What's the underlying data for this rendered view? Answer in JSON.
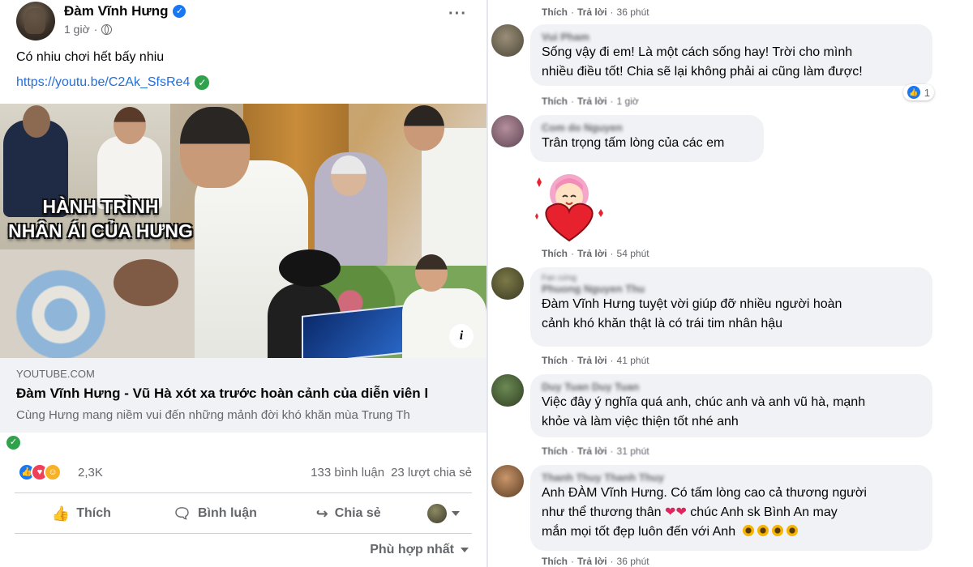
{
  "post": {
    "author": "Đàm Vĩnh Hưng",
    "time": "1 giờ",
    "text": "Có nhiu chơi hết bấy nhiu",
    "link": "https://youtu.be/C2Ak_SfsRe4",
    "thumbnail_title_line1": "HÀNH TRÌNH",
    "thumbnail_title_line2": "NHÂN ÁI CỦA HƯNG",
    "info_symbol": "i",
    "link_domain": "YOUTUBE.COM",
    "link_title": "Đàm Vĩnh Hưng - Vũ Hà xót xa trước hoàn cảnh của diễn viên l",
    "link_description": "Cùng Hưng mang niềm vui đến những mảnh đời khó khăn mùa Trung Th",
    "reaction_count": "2,3K",
    "comments_count": "133 bình luận",
    "shares_count": "23 lượt chia sẻ",
    "actions": {
      "like": "Thích",
      "comment": "Bình luận",
      "share": "Chia sẻ"
    },
    "sort_label": "Phù hợp nhất",
    "colors": {
      "accent": "#1877f2",
      "link": "#216fdb",
      "verified": "#1877f2",
      "check": "#31a24c"
    }
  },
  "comments": {
    "like_label": "Thích",
    "reply_label": "Trả lời",
    "top_meta_time": "36 phút",
    "items": [
      {
        "name": "Vui Pham",
        "text_line1": "Sống vậy đi em! Là một cách sống hay! Trời cho mình",
        "text_line2": "nhiều điều tốt! Chia sẽ lại không phải ai cũng làm được!",
        "time": "1 giờ",
        "reaction_count": "1"
      },
      {
        "name": "Com do Nguyen",
        "text_line1": "Trân trọng tấm lòng của các em",
        "time": "54 phút"
      },
      {
        "sub": "Fan cứng",
        "name": "Phuong Nguyen Thu",
        "text_line1": "Đàm Vĩnh Hưng tuyệt vời giúp đỡ nhiều người hoàn",
        "text_line2": "cảnh khó khăn thật là có trái tim nhân hậu",
        "time": "41 phút"
      },
      {
        "name": "Duy Tuan Duy Tuan",
        "text_line1": "Việc đây ý nghĩa quá anh, chúc anh và anh vũ hà, mạnh",
        "text_line2": "khỏe và làm việc thiện tốt nhé anh",
        "time": "31 phút"
      },
      {
        "name": "Thanh Thuy Thanh Thuy",
        "text_line1": "Anh ĐÀM Vĩnh Hưng. Có tấm lòng cao cả thương người",
        "text_line2a": "như thể thương thân",
        "text_line2b": "chúc Anh sk Bình An may",
        "text_line3": "mắn mọi tốt đẹp luôn đến với Anh",
        "time": "36 phút"
      }
    ]
  }
}
